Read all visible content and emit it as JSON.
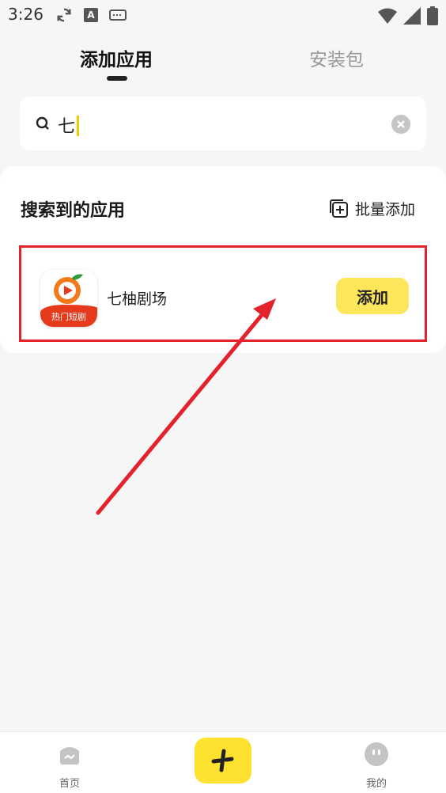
{
  "status_bar": {
    "time": "3:26"
  },
  "tabs": {
    "add_app": "添加应用",
    "install_pkg": "安装包"
  },
  "search": {
    "value": "七"
  },
  "results": {
    "title": "搜索到的应用",
    "batch_add": "批量添加",
    "app": {
      "name": "七柚剧场",
      "icon_banner": "热门短剧",
      "add_label": "添加"
    }
  },
  "bottom_nav": {
    "home": "首页",
    "mine": "我的"
  },
  "colors": {
    "accent": "#fde330",
    "highlight": "#e3222c",
    "brand_orange": "#e53a1c"
  }
}
